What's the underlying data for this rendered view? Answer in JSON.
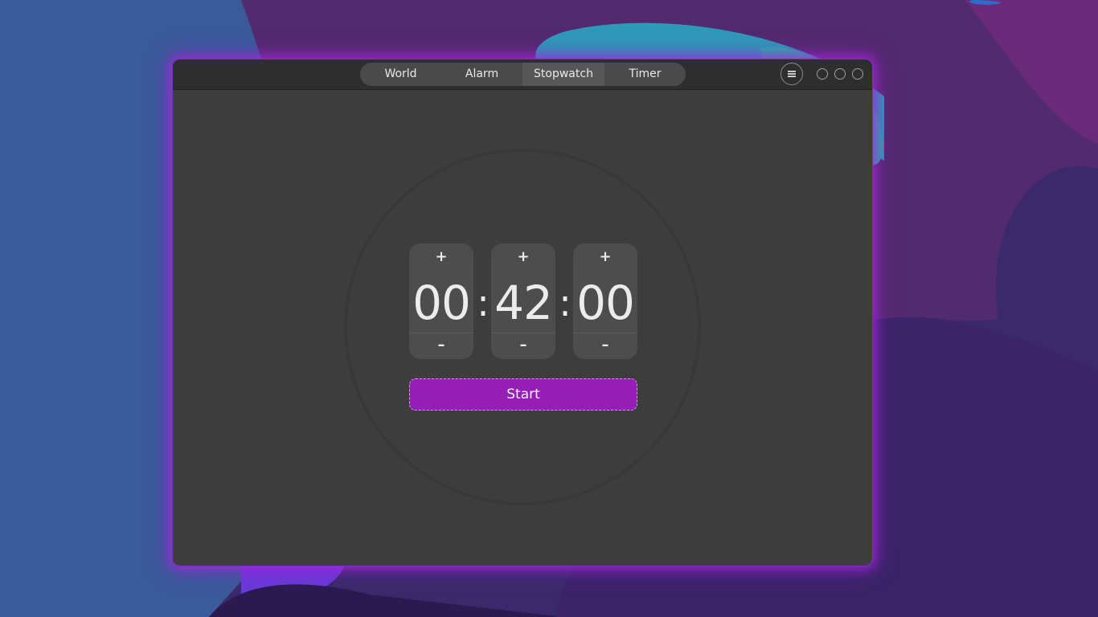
{
  "headerbar": {
    "tabs": [
      {
        "label": "World"
      },
      {
        "label": "Alarm"
      },
      {
        "label": "Stopwatch"
      },
      {
        "label": "Timer"
      }
    ],
    "active_tab": "Stopwatch",
    "menu_icon": "hamburger-menu-icon",
    "window_controls": [
      "minimize",
      "maximize",
      "close"
    ]
  },
  "timer": {
    "hours": "00",
    "minutes": "42",
    "seconds": "00",
    "separator": ":",
    "increment_symbol": "+",
    "decrement_symbol": "–",
    "start_label": "Start"
  },
  "colors": {
    "accent": "#951fb6",
    "window_bg": "#3d3d3d",
    "headerbar_bg": "#2e2e2e",
    "glow": "#a828dc"
  }
}
